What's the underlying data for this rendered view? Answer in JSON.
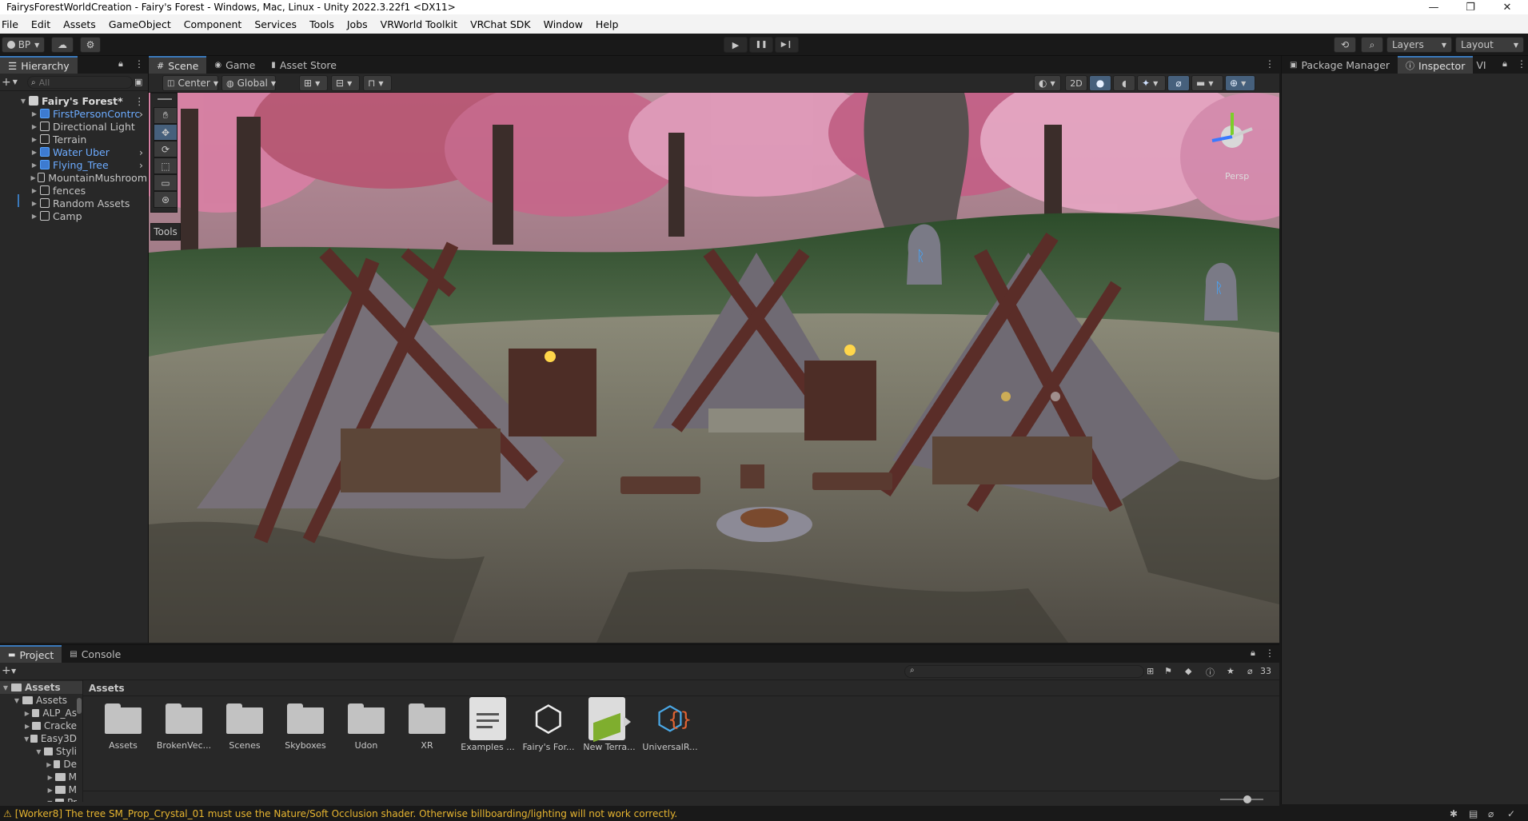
{
  "window": {
    "title": "FairysForestWorldCreation - Fairy's Forest - Windows, Mac, Linux - Unity 2022.3.22f1 <DX11>",
    "minimize": "—",
    "maximize": "❐",
    "close": "✕"
  },
  "menu": [
    "File",
    "Edit",
    "Assets",
    "GameObject",
    "Component",
    "Services",
    "Tools",
    "Jobs",
    "VRWorld Toolkit",
    "VRChat SDK",
    "Window",
    "Help"
  ],
  "toolbar": {
    "account": "BP",
    "play": "▶",
    "pause": "❚❚",
    "step": "▶❙",
    "layers": "Layers",
    "layout": "Layout"
  },
  "hierarchy": {
    "tab": "Hierarchy",
    "search_placeholder": "All",
    "scene_name": "Fairy's Forest*",
    "items": [
      {
        "label": "FirstPersonContrc",
        "blue": true
      },
      {
        "label": "Directional Light",
        "blue": false
      },
      {
        "label": "Terrain",
        "blue": false
      },
      {
        "label": "Water Uber",
        "blue": true
      },
      {
        "label": "Flying_Tree",
        "blue": true
      },
      {
        "label": "MountainMushroom",
        "blue": false
      },
      {
        "label": "fences",
        "blue": false
      },
      {
        "label": "Random Assets",
        "blue": false
      },
      {
        "label": "Camp",
        "blue": false
      }
    ]
  },
  "scene_tabs": {
    "scene": "Scene",
    "game": "Game",
    "asset_store": "Asset Store"
  },
  "scene_toolbar": {
    "pivot": "Center",
    "space": "Global",
    "mode_2d": "2D",
    "tools_label": "Tools",
    "gizmo_label": "Persp"
  },
  "right_tabs": {
    "package_manager": "Package Manager",
    "inspector": "Inspector",
    "vi": "VI"
  },
  "project": {
    "tab_project": "Project",
    "tab_console": "Console",
    "breadcrumb": "Assets",
    "hidden_count": "33",
    "tree": [
      {
        "label": "Assets",
        "indent": 0,
        "open": true
      },
      {
        "label": "Assets",
        "indent": 1,
        "open": true
      },
      {
        "label": "ALP_As",
        "indent": 2,
        "open": false
      },
      {
        "label": "Cracke",
        "indent": 2,
        "open": false
      },
      {
        "label": "Easy3D",
        "indent": 2,
        "open": true
      },
      {
        "label": "Styli",
        "indent": 3,
        "open": true
      },
      {
        "label": "De",
        "indent": 4,
        "open": false
      },
      {
        "label": "M",
        "indent": 4,
        "open": false
      },
      {
        "label": "M",
        "indent": 4,
        "open": false
      },
      {
        "label": "Pr",
        "indent": 4,
        "open": true
      }
    ],
    "assets": [
      {
        "label": "Assets",
        "kind": "folder"
      },
      {
        "label": "BrokenVec...",
        "kind": "folder"
      },
      {
        "label": "Scenes",
        "kind": "folder"
      },
      {
        "label": "Skyboxes",
        "kind": "folder"
      },
      {
        "label": "Udon",
        "kind": "folder"
      },
      {
        "label": "XR",
        "kind": "folder"
      },
      {
        "label": "Examples ...",
        "kind": "doc"
      },
      {
        "label": "Fairy's For...",
        "kind": "unity"
      },
      {
        "label": "New Terra...",
        "kind": "terrain"
      },
      {
        "label": "UniversalR...",
        "kind": "urp"
      }
    ]
  },
  "status": {
    "message": "[Worker8] The tree SM_Prop_Crystal_01 must use the Nature/Soft Occlusion shader. Otherwise billboarding/lighting will not work correctly."
  }
}
